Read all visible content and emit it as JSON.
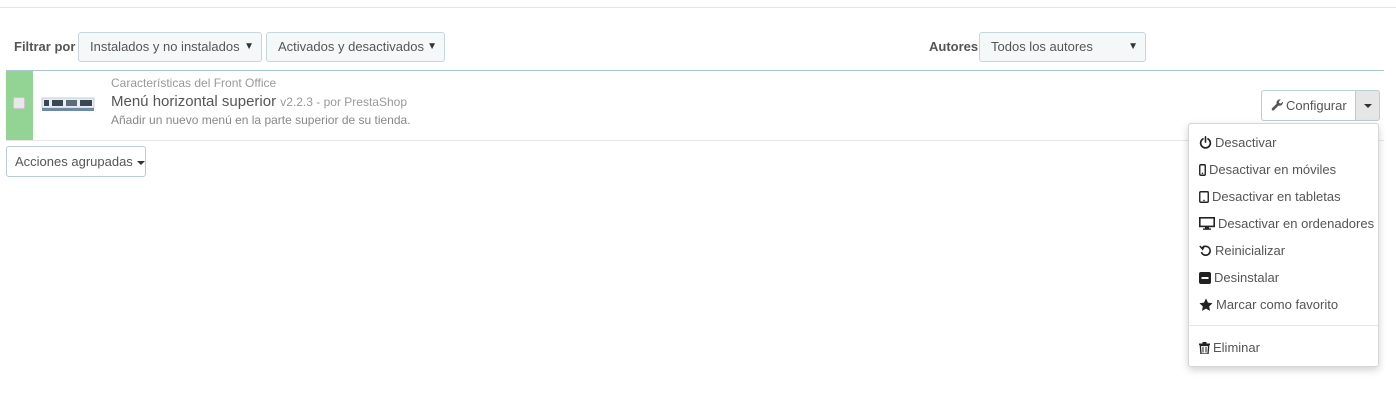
{
  "filters": {
    "label": "Filtrar por",
    "install_select": "Instalados y no instalados",
    "active_select": "Activados y desactivados",
    "authors_label": "Autores",
    "authors_select": "Todos los autores"
  },
  "module": {
    "category": "Características del Front Office",
    "name": "Menú horizontal superior",
    "version": "v2.2.3 - por PrestaShop",
    "description": "Añadir un nuevo menú en la parte superior de su tienda.",
    "status_color": "#93d393"
  },
  "actions": {
    "configure_label": "Configurar",
    "menu": [
      {
        "label": "Desactivar",
        "icon": "power-icon"
      },
      {
        "label": "Desactivar en móviles",
        "icon": "mobile-icon"
      },
      {
        "label": "Desactivar en tabletas",
        "icon": "tablet-icon"
      },
      {
        "label": "Desactivar en ordenadores",
        "icon": "desktop-icon"
      },
      {
        "label": "Reinicializar",
        "icon": "undo-icon"
      },
      {
        "label": "Desinstalar",
        "icon": "minus-square-icon"
      },
      {
        "label": "Marcar como favorito",
        "icon": "star-icon"
      },
      {
        "label": "Eliminar",
        "icon": "trash-icon"
      }
    ]
  },
  "bulk": {
    "label": "Acciones agrupadas"
  }
}
